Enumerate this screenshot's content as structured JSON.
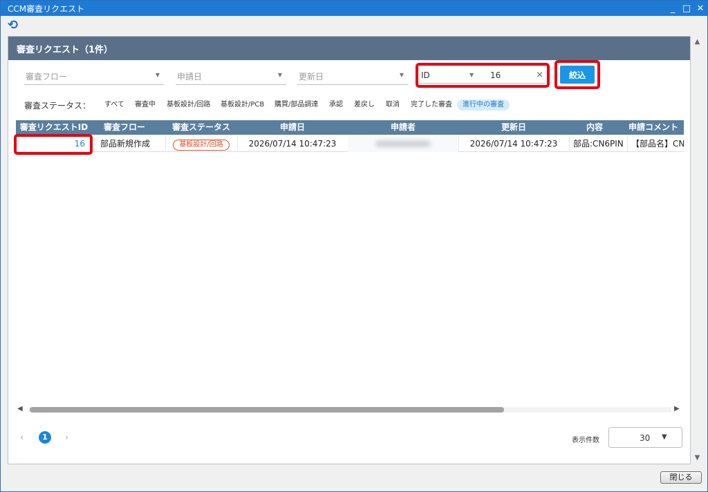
{
  "window": {
    "title": "CCM審査リクエスト",
    "controls": [
      "_",
      "□",
      "✕"
    ]
  },
  "toolbar": {
    "refresh_icon": "⟲"
  },
  "panel": {
    "title": "審査リクエスト（1件）"
  },
  "filters": {
    "flow_placeholder": "審査フロー",
    "apply_date_placeholder": "申請日",
    "update_date_placeholder": "更新日",
    "id_field_label": "ID",
    "id_value": "16",
    "clear_icon": "×",
    "apply_button": "絞込"
  },
  "status_filter": {
    "label": "審査ステータス：",
    "chips": [
      "すべて",
      "審査中",
      "基板設計/回路",
      "基板設計/PCB",
      "購買/部品調達",
      "承認",
      "差戻し",
      "取消",
      "完了した審査",
      "進行中の審査"
    ],
    "active_index": 9
  },
  "table": {
    "columns": [
      "審査リクエストID",
      "審査フロー",
      "審査ステータス",
      "申請日",
      "申請者",
      "更新日",
      "内容",
      "申請コメント"
    ],
    "rows": [
      {
        "id": "16",
        "flow": "部品新規作成",
        "status": "基板設計/回路",
        "apply_date": "2026/07/14 10:47:23",
        "applicant": "",
        "update_date": "2026/07/14 10:47:23",
        "content": "部品:CN6PIN",
        "comment": "【部品名】CN"
      }
    ]
  },
  "pagination": {
    "prev_icon": "‹",
    "next_icon": "›",
    "current_page": "1",
    "per_page_label": "表示件数",
    "per_page_value": "30"
  },
  "footer": {
    "close_button": "閉じる"
  },
  "colors": {
    "title_bar": "#1f7ad4",
    "panel_header": "#5a7088",
    "table_header": "#5a7e9e",
    "accent": "#1a96e8",
    "highlight_box": "#e60012",
    "status_pill": "#e04c24"
  }
}
